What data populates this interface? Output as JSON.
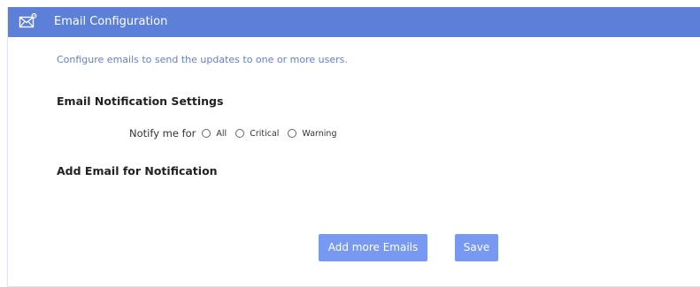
{
  "header": {
    "title": "Email Configuration",
    "icon": "envelope-gear-icon",
    "color": "#5c7fd8"
  },
  "description": "Configure emails to send the updates to one or more users.",
  "notification_settings": {
    "title": "Email Notification Settings",
    "notify_label": "Notify me for",
    "options": [
      {
        "label": "All",
        "selected": false
      },
      {
        "label": "Critical",
        "selected": false
      },
      {
        "label": "Warning",
        "selected": false
      }
    ]
  },
  "add_email_section": {
    "title": "Add Email for Notification"
  },
  "buttons": {
    "add_more_label": "Add more Emails",
    "save_label": "Save",
    "color": "#7899f2"
  }
}
